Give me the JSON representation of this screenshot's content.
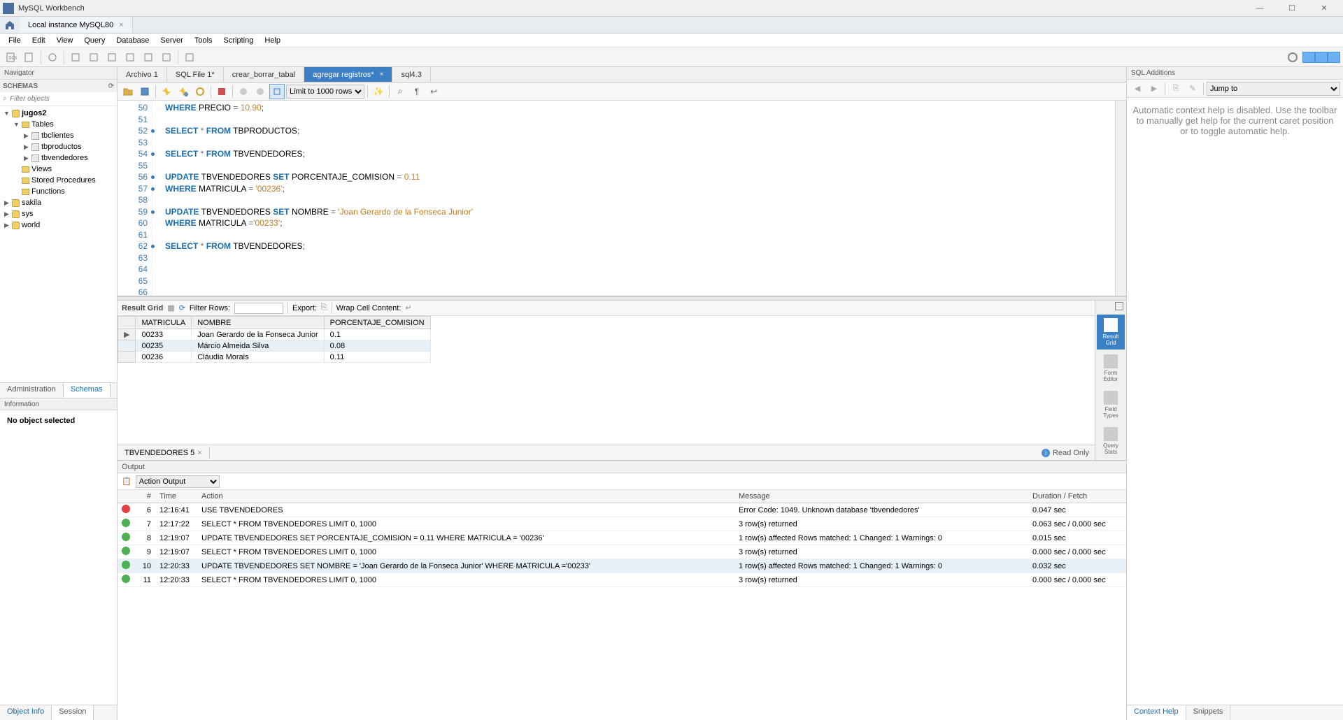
{
  "window": {
    "title": "MySQL Workbench"
  },
  "connection_tab": {
    "label": "Local instance MySQL80"
  },
  "menu": [
    "File",
    "Edit",
    "View",
    "Query",
    "Database",
    "Server",
    "Tools",
    "Scripting",
    "Help"
  ],
  "navigator": {
    "title": "Navigator",
    "schemas_label": "SCHEMAS",
    "filter_placeholder": "Filter objects",
    "tree": {
      "db1": "jugos2",
      "tables": "Tables",
      "t1": "tbclientes",
      "t2": "tbproductos",
      "t3": "tbvendedores",
      "views": "Views",
      "sp": "Stored Procedures",
      "fn": "Functions",
      "db2": "sakila",
      "db3": "sys",
      "db4": "world"
    },
    "tabs": {
      "admin": "Administration",
      "schemas": "Schemas"
    },
    "info_title": "Information",
    "info_body": "No object selected",
    "bottom_tabs": {
      "objinfo": "Object Info",
      "session": "Session"
    }
  },
  "editor_tabs": [
    {
      "label": "Archivo 1",
      "active": false
    },
    {
      "label": "SQL File 1*",
      "active": false
    },
    {
      "label": "crear_borrar_tabal",
      "active": false
    },
    {
      "label": "agregar registros*",
      "active": true
    },
    {
      "label": "sql4.3",
      "active": false
    }
  ],
  "editor_toolbar": {
    "limit": "Limit to 1000 rows"
  },
  "code": [
    {
      "n": 50,
      "dot": false,
      "html": "<span class='kw'>WHERE</span> PRECIO <span class='op'>=</span> <span class='num'>10.90</span><span class='pun'>;</span>"
    },
    {
      "n": 51,
      "dot": false,
      "html": ""
    },
    {
      "n": 52,
      "dot": true,
      "html": "<span class='kw'>SELECT</span> <span class='op'>*</span> <span class='kw'>FROM</span> TBPRODUCTOS<span class='pun'>;</span>"
    },
    {
      "n": 53,
      "dot": false,
      "html": ""
    },
    {
      "n": 54,
      "dot": true,
      "html": "<span class='kw'>SELECT</span> <span class='op'>*</span> <span class='kw'>FROM</span> TBVENDEDORES<span class='pun'>;</span>"
    },
    {
      "n": 55,
      "dot": false,
      "html": ""
    },
    {
      "n": 56,
      "dot": true,
      "html": "<span class='kw'>UPDATE</span> TBVENDEDORES <span class='kw'>SET</span> PORCENTAJE_COMISION <span class='op'>=</span> <span class='num'>0.11</span>"
    },
    {
      "n": 57,
      "dot": true,
      "html": "<span class='kw'>WHERE</span> MATRICULA <span class='op'>=</span> <span class='str'>'00236'</span><span class='pun'>;</span>"
    },
    {
      "n": 58,
      "dot": false,
      "html": ""
    },
    {
      "n": 59,
      "dot": true,
      "html": "<span class='kw'>UPDATE</span> TBVENDEDORES <span class='kw'>SET</span> NOMBRE <span class='op'>=</span> <span class='str'>'Joan Gerardo de la Fonseca Junior'</span>"
    },
    {
      "n": 60,
      "dot": false,
      "html": "<span class='kw'>WHERE</span> MATRICULA <span class='op'>=</span><span class='str'>'00233'</span><span class='pun'>;</span>"
    },
    {
      "n": 61,
      "dot": false,
      "html": ""
    },
    {
      "n": 62,
      "dot": true,
      "html": "<span class='kw'>SELECT</span> <span class='op'>*</span> <span class='kw'>FROM</span> TBVENDEDORES<span class='pun'>;</span>"
    },
    {
      "n": 63,
      "dot": false,
      "html": ""
    },
    {
      "n": 64,
      "dot": false,
      "html": ""
    },
    {
      "n": 65,
      "dot": false,
      "html": ""
    },
    {
      "n": 66,
      "dot": false,
      "html": ""
    }
  ],
  "result": {
    "toolbar": {
      "label": "Result Grid",
      "filter_label": "Filter Rows:",
      "export_label": "Export:",
      "wrap_label": "Wrap Cell Content:"
    },
    "columns": [
      "MATRICULA",
      "NOMBRE",
      "PORCENTAJE_COMISION"
    ],
    "rows": [
      {
        "sel": false,
        "cur": true,
        "c": [
          "00233",
          "Joan Gerardo de la Fonseca Junior",
          "0.1"
        ]
      },
      {
        "sel": true,
        "cur": false,
        "c": [
          "00235",
          "Márcio Almeida Silva",
          "0.08"
        ]
      },
      {
        "sel": false,
        "cur": false,
        "c": [
          "00236",
          "Cláudia Morais",
          "0.11"
        ]
      }
    ],
    "vtabs": [
      "Result Grid",
      "Form Editor",
      "Field Types",
      "Query Stats"
    ],
    "bottom_tab": "TBVENDEDORES 5",
    "readonly": "Read Only"
  },
  "output": {
    "title": "Output",
    "selector": "Action Output",
    "columns": {
      "num": "#",
      "time": "Time",
      "action": "Action",
      "message": "Message",
      "duration": "Duration / Fetch"
    },
    "rows": [
      {
        "ok": false,
        "n": 6,
        "time": "12:16:41",
        "action": "USE TBVENDEDORES",
        "msg": "Error Code: 1049. Unknown database 'tbvendedores'",
        "dur": "0.047 sec"
      },
      {
        "ok": true,
        "n": 7,
        "time": "12:17:22",
        "action": "SELECT * FROM TBVENDEDORES LIMIT 0, 1000",
        "msg": "3 row(s) returned",
        "dur": "0.063 sec / 0.000 sec"
      },
      {
        "ok": true,
        "n": 8,
        "time": "12:19:07",
        "action": "UPDATE TBVENDEDORES SET PORCENTAJE_COMISION = 0.11 WHERE MATRICULA = '00236'",
        "msg": "1 row(s) affected Rows matched: 1  Changed: 1  Warnings: 0",
        "dur": "0.015 sec"
      },
      {
        "ok": true,
        "n": 9,
        "time": "12:19:07",
        "action": "SELECT * FROM TBVENDEDORES LIMIT 0, 1000",
        "msg": "3 row(s) returned",
        "dur": "0.000 sec / 0.000 sec"
      },
      {
        "ok": true,
        "n": 10,
        "time": "12:20:33",
        "action": "UPDATE TBVENDEDORES SET NOMBRE = 'Joan Gerardo de la Fonseca Junior' WHERE MATRICULA ='00233'",
        "msg": "1 row(s) affected Rows matched: 1  Changed: 1  Warnings: 0",
        "dur": "0.032 sec",
        "sel": true
      },
      {
        "ok": true,
        "n": 11,
        "time": "12:20:33",
        "action": "SELECT * FROM TBVENDEDORES LIMIT 0, 1000",
        "msg": "3 row(s) returned",
        "dur": "0.000 sec / 0.000 sec"
      }
    ]
  },
  "right": {
    "title": "SQL Additions",
    "jump": "Jump to",
    "body": "Automatic context help is disabled. Use the toolbar to manually get help for the current caret position or to toggle automatic help.",
    "tabs": {
      "ctx": "Context Help",
      "snip": "Snippets"
    }
  }
}
